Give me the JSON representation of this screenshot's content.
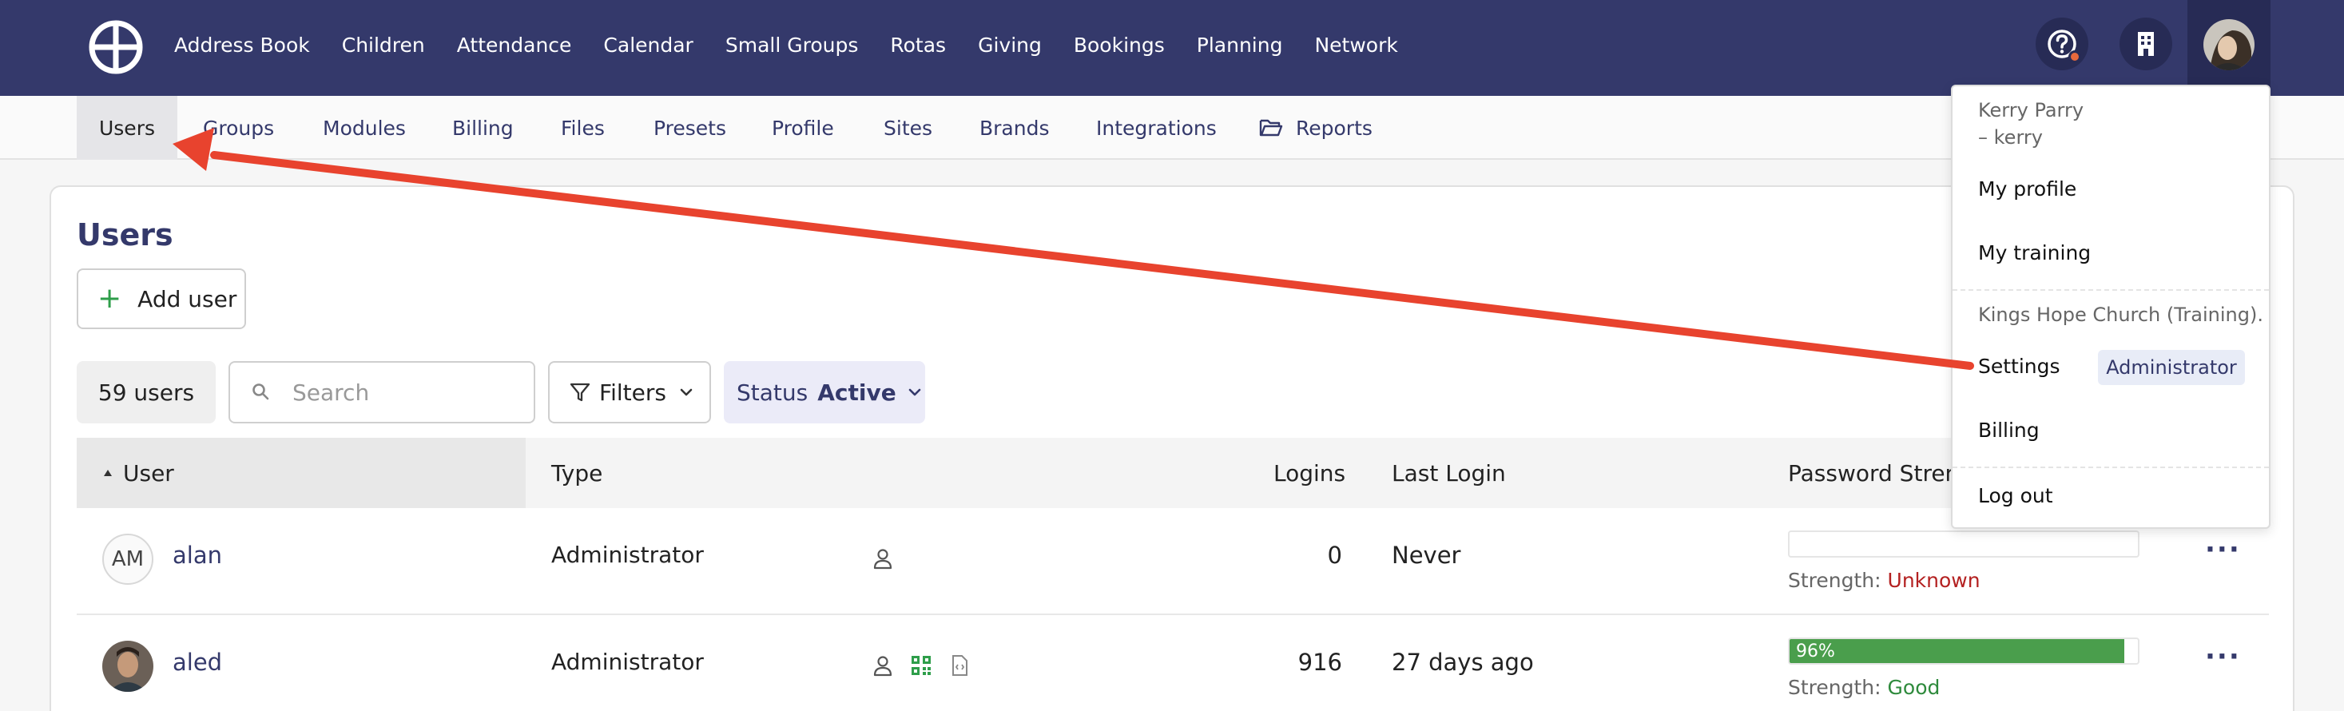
{
  "topnav": {
    "items": [
      "Address Book",
      "Children",
      "Attendance",
      "Calendar",
      "Small Groups",
      "Rotas",
      "Giving",
      "Bookings",
      "Planning",
      "Network"
    ],
    "colors": {
      "background": "#34396b",
      "icon_bg": "#272b55"
    }
  },
  "subnav": {
    "tabs": [
      "Users",
      "Groups",
      "Modules",
      "Billing",
      "Files",
      "Presets",
      "Profile",
      "Sites",
      "Brands",
      "Integrations"
    ],
    "reports": "Reports",
    "active": "Users"
  },
  "main": {
    "title": "Users",
    "add_user": "Add user",
    "user_count": "59 users",
    "search_placeholder": "Search",
    "filters": "Filters",
    "status_label": "Status",
    "status_value": "Active"
  },
  "table": {
    "columns": [
      "User",
      "Type",
      "Logins",
      "Last Login",
      "Password Stren"
    ],
    "rows": [
      {
        "initials": "AM",
        "name": "alan",
        "type": "Administrator",
        "logins": "0",
        "last_login": "Never",
        "strength_prefix": "Strength:",
        "strength_value": "Unknown",
        "strength_percent": 0,
        "strength_label": ""
      },
      {
        "initials": "",
        "name": "aled",
        "type": "Administrator",
        "logins": "916",
        "last_login": "27 days ago",
        "strength_prefix": "Strength:",
        "strength_value": "Good",
        "strength_percent": 96,
        "strength_label": "96%"
      }
    ]
  },
  "dropdown": {
    "user_name": "Kerry Parry",
    "user_handle": "– kerry",
    "my_profile": "My profile",
    "my_training": "My training",
    "org": "Kings Hope Church (Training).",
    "settings": "Settings",
    "role": "Administrator",
    "billing": "Billing",
    "logout": "Log out"
  },
  "annotation": {
    "arrow_color": "#e8432e"
  }
}
